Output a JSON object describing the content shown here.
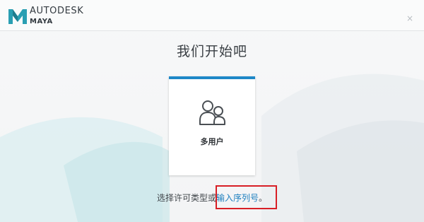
{
  "header": {
    "brand_line1": "AUTODESK",
    "brand_line2": "MAYA",
    "logo_icon": "maya-m-logo-icon",
    "close_symbol": "×"
  },
  "main": {
    "heading": "我们开始吧",
    "license_cards": [
      {
        "label": "多用户",
        "icon": "multi-user-icon"
      }
    ]
  },
  "footer": {
    "prefix_text": "选择许可类型或",
    "serial_link": "输入序列号",
    "suffix_text": "。"
  },
  "colors": {
    "accent": "#1e88c8",
    "link": "#1f7fbf",
    "highlight": "#d81f26",
    "logo": "#2a9fb3"
  }
}
